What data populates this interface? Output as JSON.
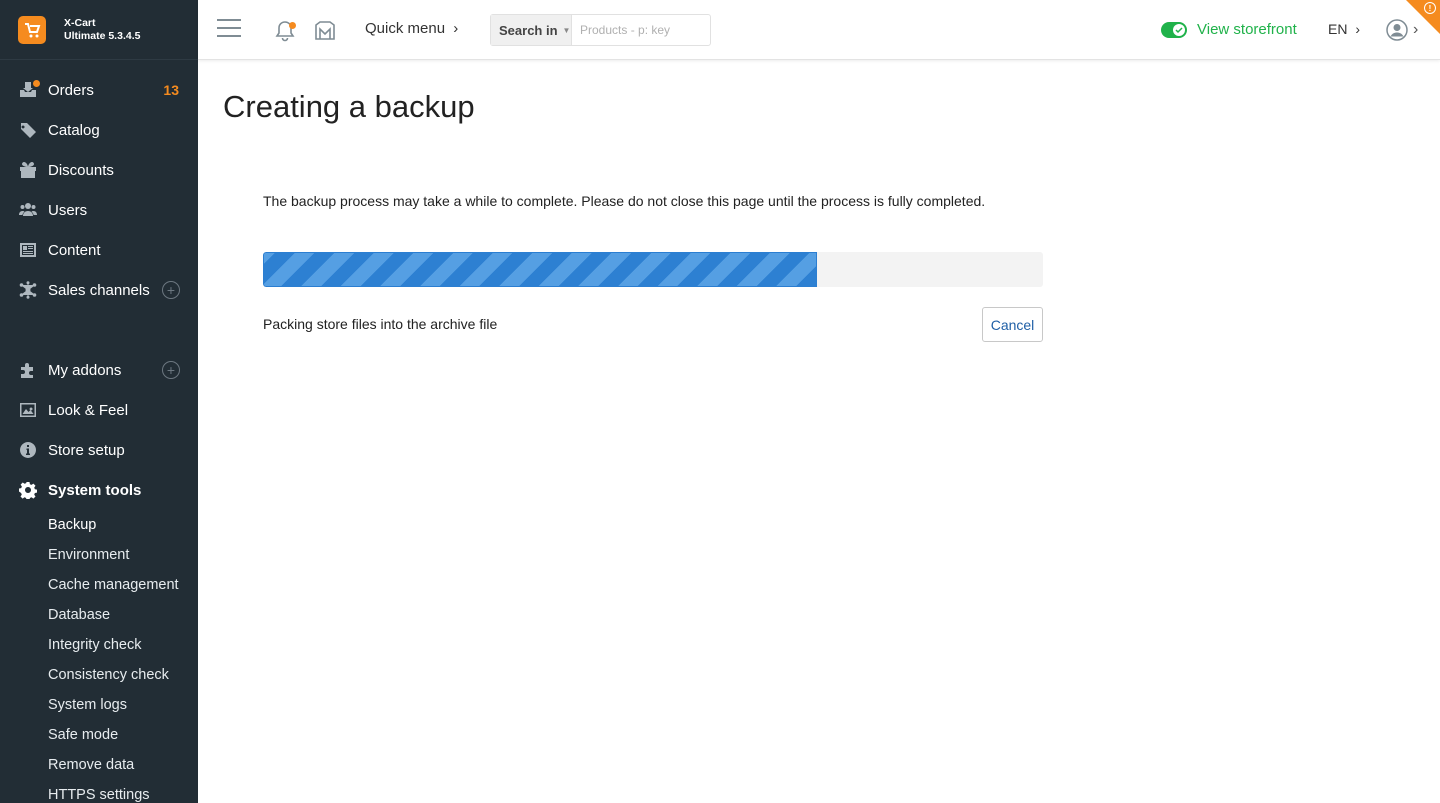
{
  "brand": {
    "line1": "X-Cart",
    "line2": "Ultimate 5.3.4.5"
  },
  "sidebar": {
    "items": [
      {
        "label": "Orders",
        "badge": "13"
      },
      {
        "label": "Catalog"
      },
      {
        "label": "Discounts"
      },
      {
        "label": "Users"
      },
      {
        "label": "Content"
      },
      {
        "label": "Sales channels"
      },
      {
        "label": "My addons"
      },
      {
        "label": "Look & Feel"
      },
      {
        "label": "Store setup"
      },
      {
        "label": "System tools"
      }
    ],
    "system_tools_sub": [
      "Backup",
      "Environment",
      "Cache management",
      "Database",
      "Integrity check",
      "Consistency check",
      "System logs",
      "Safe mode",
      "Remove data",
      "HTTPS settings"
    ]
  },
  "header": {
    "quick_menu": "Quick menu",
    "search_in": "Search in",
    "search_placeholder": "Products - p: key",
    "storefront": "View storefront",
    "language": "EN"
  },
  "main": {
    "title": "Creating a backup",
    "notice": "The backup process may take a while to complete. Please do not close this page until the process is fully completed.",
    "progress_percent": 71,
    "status": "Packing store files into the archive file",
    "cancel": "Cancel"
  },
  "colors": {
    "sidebar_bg": "#222d35",
    "accent": "#f58b1f",
    "green": "#20b24a",
    "progress": "#3a8ddc"
  },
  "icons": [
    "orders-icon",
    "tag-icon",
    "gift-icon",
    "users-icon",
    "content-icon",
    "network-icon",
    "puzzle-icon",
    "image-icon",
    "info-icon",
    "gear-icon",
    "bell-icon",
    "marketplace-icon",
    "user-icon"
  ]
}
